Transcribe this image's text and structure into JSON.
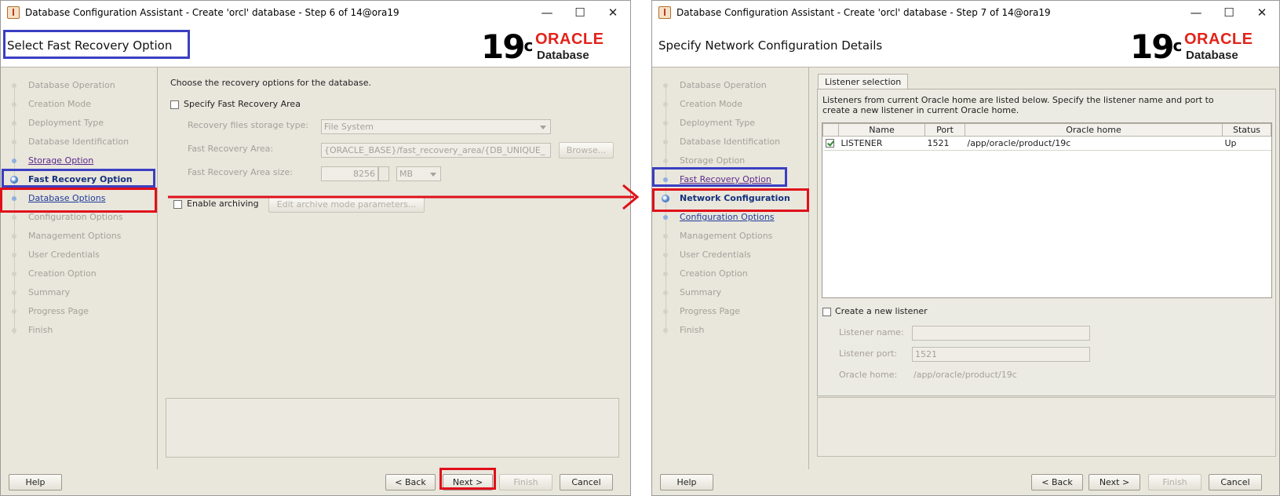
{
  "window1": {
    "title": "Database Configuration Assistant - Create 'orcl' database - Step 6 of 14@ora19",
    "controls": {
      "minimize": "—",
      "maximize": "☐",
      "close": "✕"
    },
    "header_title": "Select Fast Recovery Option",
    "logo": {
      "version": "19",
      "sup": "c",
      "brand": "ORACLE",
      "product": "Database"
    },
    "nav": [
      {
        "label": "Database Operation",
        "state": "done"
      },
      {
        "label": "Creation Mode",
        "state": "done"
      },
      {
        "label": "Deployment Type",
        "state": "done"
      },
      {
        "label": "Database Identification",
        "state": "done"
      },
      {
        "label": "Storage Option",
        "state": "link"
      },
      {
        "label": "Fast Recovery Option",
        "state": "current"
      },
      {
        "label": "Database Options",
        "state": "next"
      },
      {
        "label": "Configuration Options",
        "state": "todo"
      },
      {
        "label": "Management Options",
        "state": "todo"
      },
      {
        "label": "User Credentials",
        "state": "todo"
      },
      {
        "label": "Creation Option",
        "state": "todo"
      },
      {
        "label": "Summary",
        "state": "todo"
      },
      {
        "label": "Progress Page",
        "state": "todo"
      },
      {
        "label": "Finish",
        "state": "todo"
      }
    ],
    "instruction": "Choose the recovery options for the database.",
    "specify_fra_label": "Specify Fast Recovery Area",
    "storage_type_label": "Recovery files storage type:",
    "storage_type_value": "File System",
    "fra_label": "Fast Recovery Area:",
    "fra_value": "{ORACLE_BASE}/fast_recovery_area/{DB_UNIQUE_",
    "browse_label": "Browse...",
    "fra_size_label": "Fast Recovery Area size:",
    "fra_size_value": "8256",
    "fra_size_unit": "MB",
    "enable_archiving_label": "Enable archiving",
    "archive_params_label": "Edit archive mode parameters...",
    "buttons": {
      "help": "Help",
      "back": "< Back",
      "next": "Next >",
      "finish": "Finish",
      "cancel": "Cancel"
    }
  },
  "window2": {
    "title": "Database Configuration Assistant - Create 'orcl' database - Step 7 of 14@ora19",
    "controls": {
      "minimize": "—",
      "maximize": "☐",
      "close": "✕"
    },
    "header_title": "Specify Network Configuration Details",
    "logo": {
      "version": "19",
      "sup": "c",
      "brand": "ORACLE",
      "product": "Database"
    },
    "nav": [
      {
        "label": "Database Operation",
        "state": "done"
      },
      {
        "label": "Creation Mode",
        "state": "done"
      },
      {
        "label": "Deployment Type",
        "state": "done"
      },
      {
        "label": "Database Identification",
        "state": "done"
      },
      {
        "label": "Storage Option",
        "state": "done"
      },
      {
        "label": "Fast Recovery Option",
        "state": "link"
      },
      {
        "label": "Network Configuration",
        "state": "current"
      },
      {
        "label": "Configuration Options",
        "state": "next"
      },
      {
        "label": "Management Options",
        "state": "todo"
      },
      {
        "label": "User Credentials",
        "state": "todo"
      },
      {
        "label": "Creation Option",
        "state": "todo"
      },
      {
        "label": "Summary",
        "state": "todo"
      },
      {
        "label": "Progress Page",
        "state": "todo"
      },
      {
        "label": "Finish",
        "state": "todo"
      }
    ],
    "tab_label": "Listener selection",
    "description_line1": "Listeners from current Oracle home are listed below. Specify the listener name and port to",
    "description_line2": "create a new listener in current Oracle home.",
    "table": {
      "columns": [
        "Name",
        "Port",
        "Oracle home",
        "Status"
      ],
      "rows": [
        {
          "checked": true,
          "name": "LISTENER",
          "port": "1521",
          "home": "/app/oracle/product/19c",
          "status": "Up"
        }
      ]
    },
    "create_listener_label": "Create a new listener",
    "listener_name_label": "Listener name:",
    "listener_name_value": "",
    "listener_port_label": "Listener port:",
    "listener_port_value": "1521",
    "oracle_home_label": "Oracle home:",
    "oracle_home_value": "/app/oracle/product/19c",
    "buttons": {
      "help": "Help",
      "back": "< Back",
      "next": "Next >",
      "finish": "Finish",
      "cancel": "Cancel"
    }
  },
  "colors": {
    "highlight_blue": "#3a3fc2",
    "highlight_red": "#e0101a",
    "oracle_red": "#e2231a"
  }
}
